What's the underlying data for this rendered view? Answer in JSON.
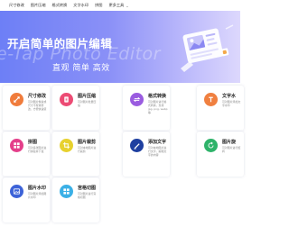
{
  "nav": {
    "items": [
      "尺寸修改",
      "图片压缩",
      "格式转换",
      "文字水印",
      "拼图",
      "更多工具"
    ],
    "more_caret": "⌄"
  },
  "hero": {
    "title": "开启简单的图片编辑",
    "watermark": "e-Tap Photo Editor",
    "subtitle": "直观 简单 高效"
  },
  "cards": [
    {
      "title": "尺寸修改",
      "desc": "可对图片像素或尺寸不有效修改，方便快速使",
      "color": "#f07c3c",
      "icon": "resize-icon"
    },
    {
      "title": "图片压缩",
      "desc": "可对图片批量压缩",
      "color": "#ec4b74",
      "icon": "compress-icon"
    },
    {
      "title": "格式转换",
      "desc": "可对图片进行格式转换，支持 jpg, png, webp 等",
      "color": "#9a5ce0",
      "icon": "convert-icon"
    },
    {
      "title": "文字水",
      "desc": "可对图片添加文字水印",
      "color": "#f08040",
      "icon": "text-watermark-icon"
    },
    {
      "title": "拼图",
      "desc": "可对多张图片进行拼接并下载",
      "color": "#e43f8a",
      "icon": "puzzle-icon"
    },
    {
      "title": "图片裁剪",
      "desc": "可对本地图片进行裁剪",
      "color": "#e7d12e",
      "icon": "crop-icon"
    },
    {
      "title": "添加文字",
      "desc": "可对本地图片进行文字，编辑文字的内容",
      "color": "#1e3fa0",
      "icon": "add-text-icon"
    },
    {
      "title": "图片旋",
      "desc": "可对图片进行旋转",
      "color": "#2fb36a",
      "icon": "rotate-icon"
    },
    {
      "title": "图片水印",
      "desc": "可对图片添加图片水印",
      "color": "#3d63d8",
      "icon": "image-watermark-icon"
    },
    {
      "title": "宫格切图",
      "desc": "可对图片进行宫格切图",
      "color": "#3bb0e6",
      "icon": "grid-cut-icon"
    }
  ]
}
